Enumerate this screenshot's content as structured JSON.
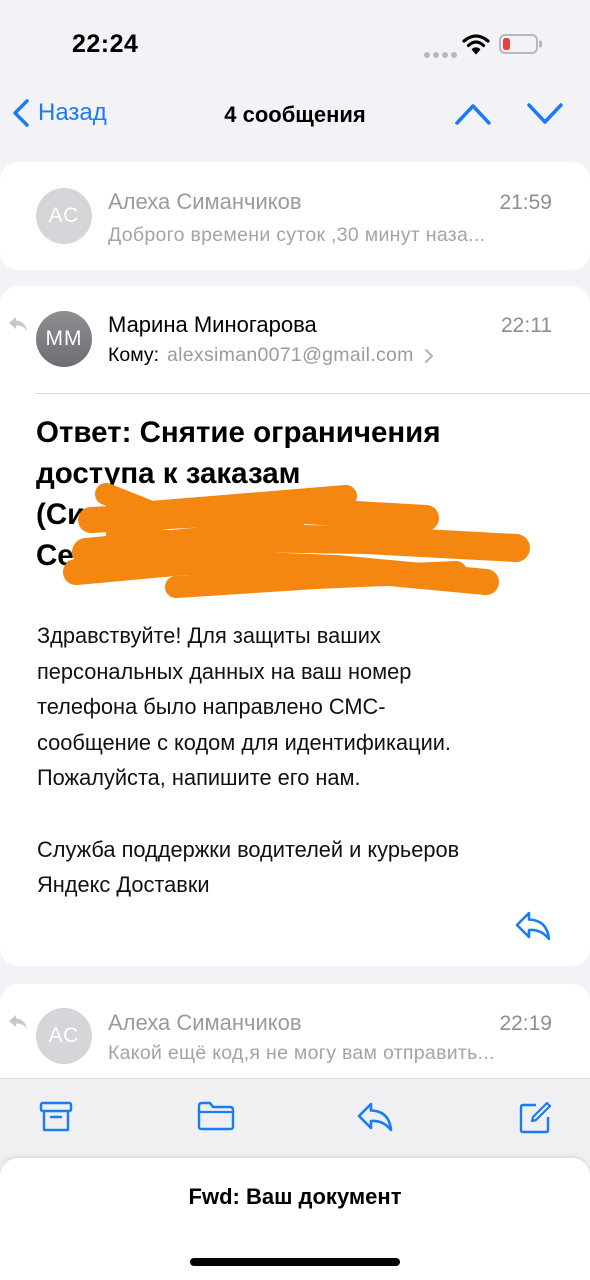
{
  "status": {
    "time": "22:24"
  },
  "nav": {
    "back_label": "Назад",
    "title": "4 сообщения"
  },
  "messages": [
    {
      "initials": "АС",
      "sender": "Алеха Симанчиков",
      "time": "21:59",
      "preview": "Доброго времени суток ,30 минут наза..."
    },
    {
      "initials": "ММ",
      "sender": "Марина Миногарова",
      "time": "22:11",
      "to_label": "Кому:",
      "to_address": "alexsiman0071@gmail.com",
      "subject_lines": [
        "Ответ: Снятие ограничения",
        "доступа к заказам",
        "(Сим      Алексей",
        "Се                    00722)"
      ],
      "body_paragraph_1": [
        "Здравствуйте! Для защиты ваших",
        "персональных данных на ваш номер",
        "телефона было направлено СМС-",
        "сообщение с кодом для идентификации.",
        "Пожалуйста, напишите его нам."
      ],
      "body_paragraph_2": [
        "Служба поддержки водителей и курьеров",
        "Яндекс Доставки"
      ]
    },
    {
      "initials": "АС",
      "sender": "Алеха Симанчиков",
      "time": "22:19",
      "preview": "Какой ещё код,я не могу вам отправить..."
    }
  ],
  "draft": {
    "title": "Fwd: Ваш документ"
  },
  "colors": {
    "accent": "#1a7cf5",
    "redaction": "#f5860f",
    "battery_low": "#e8403a"
  }
}
